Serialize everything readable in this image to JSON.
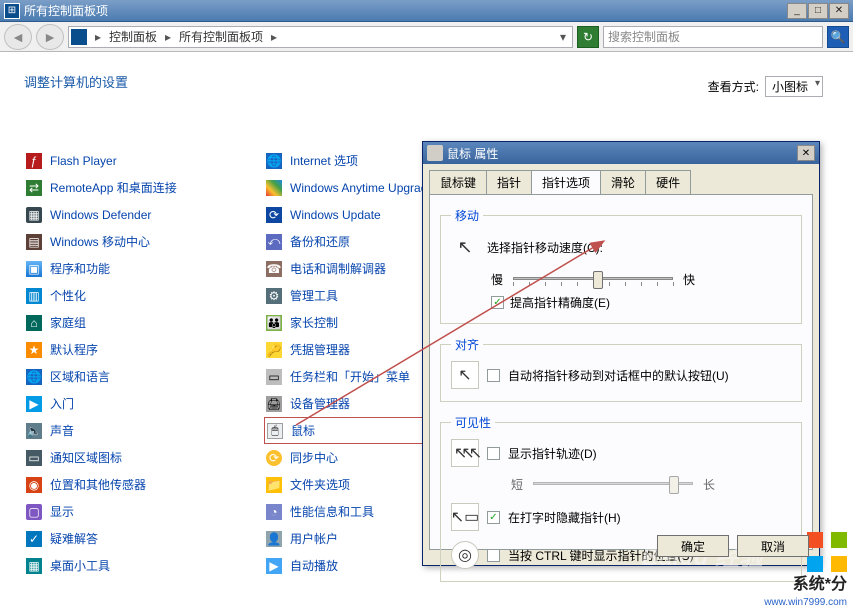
{
  "title": "所有控制面板项",
  "breadcrumbs": {
    "lvl1": "控制面板",
    "lvl2": "所有控制面板项"
  },
  "search_placeholder": "搜索控制面板",
  "settings_heading": "调整计算机的设置",
  "view_label": "查看方式:",
  "view_value": "小图标",
  "items_left": [
    "Flash Player",
    "RemoteApp 和桌面连接",
    "Windows Defender",
    "Windows 移动中心",
    "程序和功能",
    "个性化",
    "家庭组",
    "默认程序",
    "区域和语言",
    "入门",
    "声音",
    "通知区域图标",
    "位置和其他传感器",
    "显示",
    "疑难解答",
    "桌面小工具"
  ],
  "items_right": [
    "Internet 选项",
    "Windows Anytime Upgrade",
    "Windows Update",
    "备份和还原",
    "电话和调制解调器",
    "管理工具",
    "家长控制",
    "凭据管理器",
    "任务栏和「开始」菜单",
    "设备管理器",
    "鼠标",
    "同步中心",
    "文件夹选项",
    "性能信息和工具",
    "用户帐户",
    "自动播放"
  ],
  "dialog": {
    "title": "鼠标 属性",
    "tabs": [
      "鼠标键",
      "指针",
      "指针选项",
      "滑轮",
      "硬件"
    ],
    "group_motion": "移动",
    "speed_label": "选择指针移动速度(C):",
    "slow": "慢",
    "fast": "快",
    "enhance": "提高指针精确度(E)",
    "group_snap": "对齐",
    "snap_label": "自动将指针移动到对话框中的默认按钮(U)",
    "group_vis": "可见性",
    "trails_label": "显示指针轨迹(D)",
    "short": "短",
    "long": "长",
    "hide_typing": "在打字时隐藏指针(H)",
    "ctrl_locate": "当按 CTRL 键时显示指针的位置(S)",
    "ok": "确定",
    "cancel": "取消"
  },
  "watermark": {
    "brand": "系统*分",
    "url": "www.win7999.com"
  }
}
